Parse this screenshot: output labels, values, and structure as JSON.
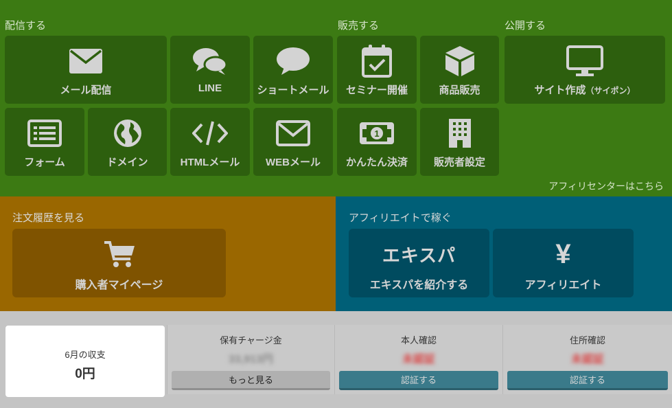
{
  "sections": {
    "distribute": "配信する",
    "sell": "販売する",
    "publish": "公開する"
  },
  "tiles": {
    "mail": "メール配信",
    "line": "LINE",
    "short_mail": "ショートメール",
    "seminar": "セミナー開催",
    "product_sales": "商品販売",
    "site_create": "サイト作成",
    "site_create_sub": "（サイポン）",
    "form": "フォーム",
    "domain": "ドメイン",
    "html_mail": "HTMLメール",
    "web_mail": "WEBメール",
    "easy_payment": "かんたん決済",
    "seller_settings": "販売者設定"
  },
  "affiliate_center_link": "アフィリセンターはこちら",
  "orders": {
    "label": "注文履歴を見る",
    "buyer_page": "購入者マイページ"
  },
  "affiliate": {
    "label": "アフィリエイトで稼ぐ",
    "ekispa_logo": "エキスパ",
    "ekispa_intro": "エキスパを紹介する",
    "yen_symbol": "¥",
    "affiliate": "アフィリエイト"
  },
  "income": {
    "title": "6月の収支",
    "value": "0円"
  },
  "charge": {
    "title": "保有チャージ金",
    "value": "33,913円",
    "button": "もっと見る"
  },
  "identity": {
    "title": "本人確認",
    "status": "未認証",
    "button": "認証する"
  },
  "address": {
    "title": "住所確認",
    "status": "未認証",
    "button": "認証する"
  },
  "colors": {
    "green_bg": "#3c7a13",
    "green_tile": "#2d5f0e",
    "orange_bg": "#9a6700",
    "orange_tile": "#7f5300",
    "teal_bg": "#005f77",
    "teal_tile": "#004b5f",
    "status_red": "#d94a4a"
  }
}
